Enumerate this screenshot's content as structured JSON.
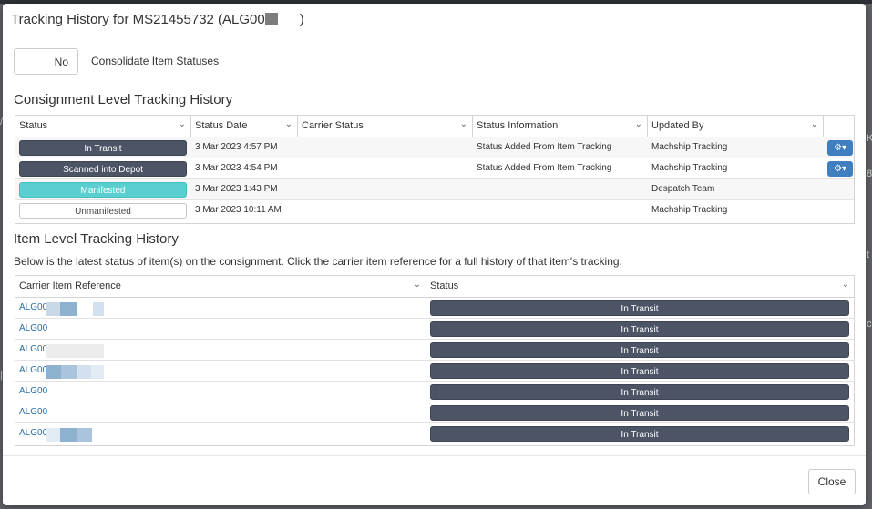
{
  "modal": {
    "title_prefix": "Tracking History for MS21455732 (ALG00",
    "title_suffix": ")"
  },
  "consolidate": {
    "value": "No",
    "label": "Consolidate Item Statuses"
  },
  "consignment": {
    "title": "Consignment Level Tracking History",
    "columns": [
      "Status",
      "Status Date",
      "Carrier Status",
      "Status Information",
      "Updated By"
    ],
    "rows": [
      {
        "status": "In Transit",
        "style": "dark",
        "date": "3 Mar 2023 4:57 PM",
        "carrier_status": "",
        "info": "Status Added From Item Tracking",
        "updated_by": "Machship Tracking",
        "has_actions": true
      },
      {
        "status": "Scanned into Depot",
        "style": "dark",
        "date": "3 Mar 2023 4:54 PM",
        "carrier_status": "",
        "info": "Status Added From Item Tracking",
        "updated_by": "Machship Tracking",
        "has_actions": true
      },
      {
        "status": "Manifested",
        "style": "teal",
        "date": "3 Mar 2023 1:43 PM",
        "carrier_status": "",
        "info": "",
        "updated_by": "Despatch Team",
        "has_actions": false
      },
      {
        "status": "Unmanifested",
        "style": "white",
        "date": "3 Mar 2023 10:11 AM",
        "carrier_status": "",
        "info": "",
        "updated_by": "Machship Tracking",
        "has_actions": false
      }
    ]
  },
  "items": {
    "title": "Item Level Tracking History",
    "description": "Below is the latest status of item(s) on the consignment. Click the carrier item reference for a full history of that item's tracking.",
    "columns": [
      "Carrier Item Reference",
      "Status"
    ],
    "rows": [
      {
        "ref": "ALG00",
        "status": "In Transit"
      },
      {
        "ref": "ALG00",
        "status": "In Transit"
      },
      {
        "ref": "ALG00",
        "status": "In Transit"
      },
      {
        "ref": "ALG00",
        "status": "In Transit"
      },
      {
        "ref": "ALG00",
        "status": "In Transit"
      },
      {
        "ref": "ALG00",
        "status": "In Transit"
      },
      {
        "ref": "ALG00",
        "status": "In Transit"
      }
    ]
  },
  "footer": {
    "close_label": "Close"
  },
  "icons": {
    "column_menu": "chevron-down-icon",
    "row_actions": "gear-icon"
  },
  "colors": {
    "status_dark": "#4c5466",
    "status_teal": "#5bcfd0",
    "link": "#2a6fa8",
    "action_button": "#3f7fbf"
  }
}
